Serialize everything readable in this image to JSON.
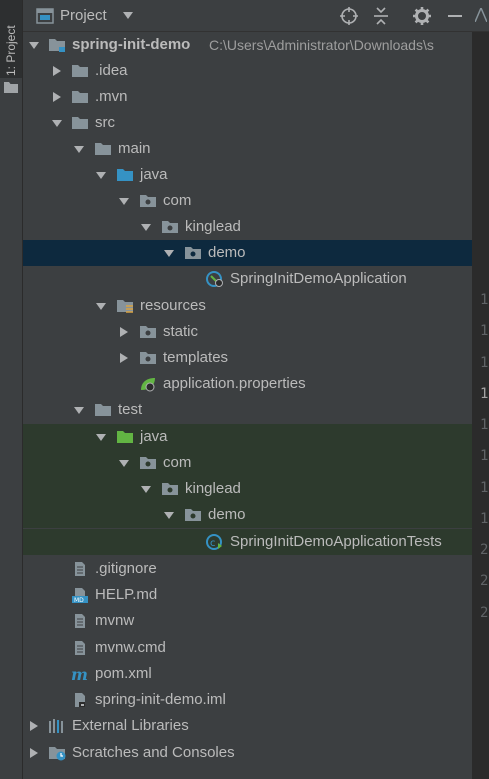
{
  "sidebar": {
    "tab_label": "1: Project"
  },
  "header": {
    "title": "Project",
    "buttons": [
      "locate-icon",
      "collapse-all-icon",
      "settings-gear-icon",
      "hide-minus-icon"
    ]
  },
  "tree": {
    "root": {
      "label": "spring-init-demo",
      "path": "C:\\Users\\Administrator\\Downloads\\s"
    },
    "idea": ".idea",
    "mvn": ".mvn",
    "src": "src",
    "main": "main",
    "main_java": "java",
    "main_com": "com",
    "main_kinglead": "kinglead",
    "main_demo": "demo",
    "main_app": "SpringInitDemoApplication",
    "resources": "resources",
    "static": "static",
    "templates": "templates",
    "props": "application.properties",
    "test": "test",
    "test_java": "java",
    "test_com": "com",
    "test_kinglead": "kinglead",
    "test_demo": "demo",
    "test_app": "SpringInitDemoApplicationTests",
    "gitignore": ".gitignore",
    "help": "HELP.md",
    "mvnw": "mvnw",
    "mvnw_cmd": "mvnw.cmd",
    "pom": "pom.xml",
    "iml": "spring-init-demo.iml",
    "ext_libs": "External Libraries",
    "scratches": "Scratches and Consoles"
  },
  "editor": {
    "line_numbers": [
      "1",
      "1",
      "1",
      "1",
      "1",
      "1",
      "1",
      "1",
      "2",
      "2",
      "2"
    ]
  },
  "colors": {
    "panel_bg": "#3c3f41",
    "selection_bg": "#0d293e",
    "test_bg": "#2d3a2d",
    "folder_gray": "#87939a",
    "folder_blue": "#3592c4",
    "folder_green": "#62b543"
  }
}
